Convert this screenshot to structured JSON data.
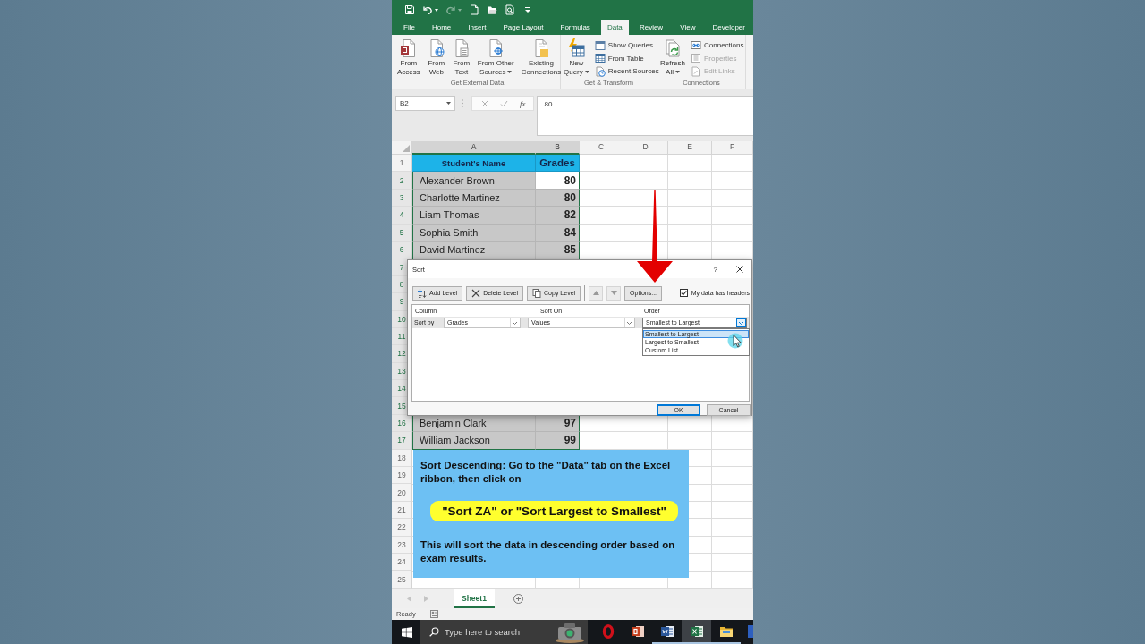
{
  "quick_access_toolbar": [
    {
      "disabled": false
    },
    {
      "disabled": false
    },
    {
      "disabled": true
    },
    {
      "disabled": false
    },
    {
      "disabled": false
    },
    {
      "disabled": false
    },
    {
      "disabled": false
    }
  ],
  "ribbon_tabs": [
    {
      "label": "File",
      "selected": false
    },
    {
      "label": "Home",
      "selected": false
    },
    {
      "label": "Insert",
      "selected": false
    },
    {
      "label": "Page Layout",
      "selected": false
    },
    {
      "label": "Formulas",
      "selected": false
    },
    {
      "label": "Data",
      "selected": true
    },
    {
      "label": "Review",
      "selected": false
    },
    {
      "label": "View",
      "selected": false
    },
    {
      "label": "Developer",
      "selected": false
    }
  ],
  "ribbon": {
    "groups": [
      {
        "label": "Get External Data",
        "items": [
          {
            "kind": "large",
            "label": "From\nAccess",
            "dropdown": false,
            "disabled": false
          },
          {
            "kind": "large",
            "label": "From\nWeb",
            "dropdown": false,
            "disabled": false
          },
          {
            "kind": "large",
            "label": "From\nText",
            "dropdown": false,
            "disabled": false
          },
          {
            "kind": "large",
            "label": "From Other\nSources",
            "dropdown": true,
            "disabled": false
          },
          {
            "kind": "large",
            "label": "Existing\nConnections",
            "dropdown": false,
            "disabled": false
          }
        ]
      },
      {
        "label": "Get & Transform",
        "items": [
          {
            "kind": "large",
            "label": "New\nQuery",
            "dropdown": true,
            "disabled": false
          },
          {
            "kind": "small",
            "label": "Show Queries",
            "dropdown": false,
            "disabled": false
          },
          {
            "kind": "small",
            "label": "From Table",
            "dropdown": false,
            "disabled": false
          },
          {
            "kind": "small",
            "label": "Recent Sources",
            "dropdown": false,
            "disabled": false
          }
        ]
      },
      {
        "label": "Connections",
        "items": [
          {
            "kind": "large",
            "label": "Refresh\nAll",
            "dropdown": true,
            "disabled": false
          },
          {
            "kind": "small",
            "label": "Connections",
            "dropdown": false,
            "disabled": false
          },
          {
            "kind": "small",
            "label": "Properties",
            "dropdown": false,
            "disabled": true
          },
          {
            "kind": "small",
            "label": "Edit Links",
            "dropdown": false,
            "disabled": true
          }
        ]
      }
    ]
  },
  "formula_bar": {
    "name_box": "B2",
    "function_button": "fx",
    "formula": "80"
  },
  "sheet": {
    "columns": [
      {
        "label": "A",
        "selected": true
      },
      {
        "label": "B",
        "selected": true
      },
      {
        "label": "C",
        "selected": false
      },
      {
        "label": "D",
        "selected": false
      },
      {
        "label": "E",
        "selected": false
      },
      {
        "label": "F",
        "selected": false
      }
    ],
    "rows": [
      {
        "number": "1",
        "kind": "header",
        "selected": false,
        "cells": [
          {
            "text": "Student's Name",
            "active": false
          },
          {
            "text": "Grades",
            "active": false
          }
        ]
      },
      {
        "number": "2",
        "kind": "data",
        "selected": true,
        "cells": [
          {
            "text": "Alexander Brown",
            "active": false
          },
          {
            "text": "80",
            "active": true
          }
        ]
      },
      {
        "number": "3",
        "kind": "data",
        "selected": true,
        "cells": [
          {
            "text": "Charlotte Martinez",
            "active": false
          },
          {
            "text": "80",
            "active": false
          }
        ]
      },
      {
        "number": "4",
        "kind": "data",
        "selected": true,
        "cells": [
          {
            "text": "Liam Thomas",
            "active": false
          },
          {
            "text": "82",
            "active": false
          }
        ]
      },
      {
        "number": "5",
        "kind": "data",
        "selected": true,
        "cells": [
          {
            "text": "Sophia Smith",
            "active": false
          },
          {
            "text": "84",
            "active": false
          }
        ]
      },
      {
        "number": "6",
        "kind": "data",
        "selected": true,
        "cells": [
          {
            "text": "David Martinez",
            "active": false
          },
          {
            "text": "85",
            "active": false
          }
        ]
      },
      {
        "number": "7",
        "kind": "data",
        "selected": true
      },
      {
        "number": "8",
        "kind": "data",
        "selected": true
      },
      {
        "number": "9",
        "kind": "data",
        "selected": true
      },
      {
        "number": "10",
        "kind": "data",
        "selected": true
      },
      {
        "number": "11",
        "kind": "data",
        "selected": true
      },
      {
        "number": "12",
        "kind": "data",
        "selected": true
      },
      {
        "number": "13",
        "kind": "data",
        "selected": true
      },
      {
        "number": "14",
        "kind": "data",
        "selected": true
      },
      {
        "number": "15",
        "kind": "data",
        "selected": true
      },
      {
        "number": "16",
        "kind": "data",
        "selected": true,
        "cells": [
          {
            "text": "Benjamin Clark",
            "active": false
          },
          {
            "text": "97",
            "active": false
          }
        ]
      },
      {
        "number": "17",
        "kind": "data",
        "selected": true,
        "cells": [
          {
            "text": "William Jackson",
            "active": false
          },
          {
            "text": "99",
            "active": false
          }
        ]
      },
      {
        "number": "18",
        "kind": "empty",
        "selected": false
      },
      {
        "number": "19",
        "kind": "empty",
        "selected": false
      },
      {
        "number": "20",
        "kind": "empty",
        "selected": false
      },
      {
        "number": "21",
        "kind": "empty",
        "selected": false
      },
      {
        "number": "22",
        "kind": "empty",
        "selected": false
      },
      {
        "number": "23",
        "kind": "empty",
        "selected": false
      },
      {
        "number": "24",
        "kind": "empty",
        "selected": false
      },
      {
        "number": "25",
        "kind": "empty",
        "selected": false
      }
    ]
  },
  "sheet_tabs": [
    {
      "label": "Sheet1",
      "selected": true
    }
  ],
  "status_bar": {
    "text": "Ready"
  },
  "sort_dialog": {
    "title": "Sort",
    "help": "?",
    "toolbar": [
      {
        "kind": "labeled",
        "label": "Add Level",
        "disabled": false
      },
      {
        "kind": "labeled",
        "label": "Delete Level",
        "disabled": false
      },
      {
        "kind": "labeled",
        "label": "Copy Level",
        "disabled": false
      },
      {
        "kind": "arrow",
        "disabled": true
      },
      {
        "kind": "arrow",
        "disabled": true
      },
      {
        "kind": "labeled",
        "label": "Options...",
        "disabled": false
      }
    ],
    "headers_checkbox": {
      "label": "My data has headers",
      "checked": true
    },
    "columns": [
      "Column",
      "Sort On",
      "Order"
    ],
    "level": {
      "label": "Sort by",
      "dropdowns": [
        {
          "value": "Grades",
          "expanded": false
        },
        {
          "value": "Values",
          "expanded": false
        },
        {
          "value": "Smallest to Largest",
          "expanded": true,
          "options": [
            {
              "label": "Smallest to Largest",
              "selected": true
            },
            {
              "label": "Largest to Smallest",
              "selected": false
            },
            {
              "label": "Custom List...",
              "selected": false
            }
          ]
        }
      ]
    },
    "buttons": [
      {
        "label": "OK",
        "default": true
      },
      {
        "label": "Cancel",
        "default": false
      }
    ]
  },
  "callout": {
    "paragraphs": [
      {
        "kind": "text",
        "text": "Sort Descending: Go to the \"Data\" tab on the Excel ribbon, then click on"
      },
      {
        "kind": "highlight",
        "text": "\"Sort ZA\" or \"Sort Largest to Smallest\""
      },
      {
        "kind": "text",
        "text": "This will sort the data in descending order based on exam results."
      }
    ]
  },
  "taskbar": {
    "search": {
      "placeholder": "Type here to search"
    },
    "apps": [
      {
        "selected": false,
        "open": false
      },
      {
        "selected": false,
        "open": false
      },
      {
        "selected": false,
        "open": true
      },
      {
        "selected": true,
        "open": true
      },
      {
        "selected": false,
        "open": true
      },
      {
        "selected": false,
        "open": false
      }
    ]
  }
}
